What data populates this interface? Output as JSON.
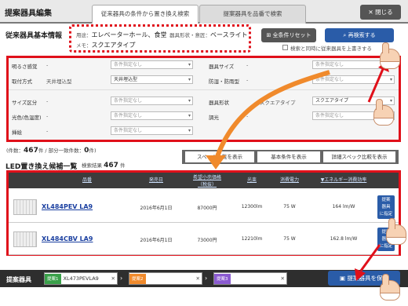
{
  "header": {
    "title": "提案器具編集",
    "tabs": [
      {
        "label": "従来器具の条件から置き換え検索"
      },
      {
        "label": "提案器具を品番で検索"
      }
    ],
    "close_label": "閉じる"
  },
  "basic_info": {
    "title": "従来器具基本情報",
    "use_key": "用途：",
    "use_value": "エレベーターホール、食堂",
    "shape_key": "器具形状・意匠：",
    "shape_value": "ベースライト",
    "memo_key": "メモ：",
    "memo_value": "スクエアタイプ"
  },
  "actions": {
    "reset_label": "全条件リセット",
    "research_label": "再検索する",
    "simultaneous_label": "検索と同時に従来器具を上書きする"
  },
  "filters": [
    {
      "label": "明るさ感覚",
      "value": "-",
      "select": "条件指定なし",
      "active": false
    },
    {
      "label": "器具サイズ",
      "value": "-",
      "select": "条件指定なし",
      "active": false
    },
    {
      "label": "取付方式",
      "value": "天井埋込型",
      "select": "天井埋込型",
      "active": true
    },
    {
      "label": "防湿・防雨型",
      "value": "-",
      "select": "条件指定なし",
      "active": false
    },
    {
      "label": "サイズ区分",
      "value": "-",
      "select": "条件指定なし",
      "active": false
    },
    {
      "label": "器具形状",
      "value": "スクエアタイプ",
      "select": "スクエアタイプ",
      "active": true
    },
    {
      "label": "光色(色温度)",
      "value": "-",
      "select": "条件指定なし",
      "active": false
    },
    {
      "label": "調光",
      "value": "-",
      "select": "条件指定なし",
      "active": false
    },
    {
      "label": "挿絵",
      "value": "-",
      "select": "条件指定なし",
      "active": false
    }
  ],
  "counts": {
    "prefix": "(件数：",
    "total": "467",
    "mid": "件 / 部分一致件数：",
    "partial": "0",
    "suffix": "件)"
  },
  "view_buttons": [
    {
      "label": "スペック一覧を表示"
    },
    {
      "label": "基本条件を表示"
    },
    {
      "label": "詳細スペック比較を表示"
    }
  ],
  "list": {
    "title": "LED置き換え候補一覧",
    "count_label": "検索結果",
    "count": "467",
    "count_unit": "件"
  },
  "table": {
    "headers": {
      "product": "品番",
      "release": "発売日",
      "price_line1": "希望小売価格",
      "price_line2": "（税抜）",
      "flux": "光束",
      "power": "消費電力",
      "efficiency": "▼エネルギー消費効率"
    },
    "rows": [
      {
        "model": "XL484PEV LA9",
        "release": "2016年6月1日",
        "price": "87000円",
        "flux": "12300lm",
        "power": "75 W",
        "efficiency": "164 lm/W"
      },
      {
        "model": "XL484CBV LA9",
        "release": "2016年6月1日",
        "price": "73000円",
        "flux": "12210lm",
        "power": "75 W",
        "efficiency": "162.8 lm/W"
      }
    ],
    "propose_label": "提案\n器具\nに指定"
  },
  "compare": {
    "label": "提案器具",
    "slots": [
      {
        "tag": "提案1",
        "value": "XL473PEVLA9",
        "color": "#3aa04a"
      },
      {
        "tag": "提案2",
        "value": "",
        "color": "#f08a2c"
      },
      {
        "tag": "提案3",
        "value": "",
        "color": "#8a5ad0"
      }
    ],
    "save_label": "提案器具を保存"
  },
  "colors": {
    "highlight": "#e0101a",
    "arrow": "#f08a2c",
    "accent_blue": "#2a5ca8"
  }
}
